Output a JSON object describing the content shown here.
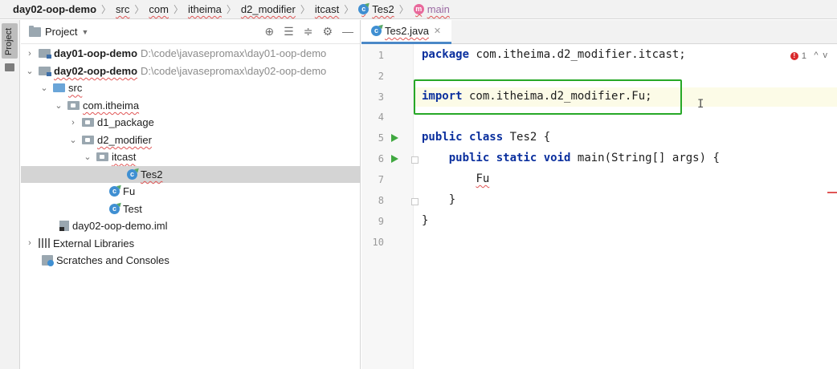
{
  "breadcrumb": {
    "items": [
      "day02-oop-demo",
      "src",
      "com",
      "itheima",
      "d2_modifier",
      "itcast",
      "Tes2",
      "main"
    ],
    "separator": "〉"
  },
  "toolstrip": {
    "project_tab": "Project"
  },
  "project_panel": {
    "title": "Project",
    "tree": [
      {
        "label": "day01-oop-demo",
        "path": "D:\\code\\javasepromax\\day01-oop-demo"
      },
      {
        "label": "day02-oop-demo",
        "path": "D:\\code\\javasepromax\\day02-oop-demo"
      },
      {
        "label": "src"
      },
      {
        "label": "com.itheima"
      },
      {
        "label": "d1_package"
      },
      {
        "label": "d2_modifier"
      },
      {
        "label": "itcast"
      },
      {
        "label": "Tes2"
      },
      {
        "label": "Fu"
      },
      {
        "label": "Test"
      },
      {
        "label": "day02-oop-demo.iml"
      },
      {
        "label": "External Libraries"
      },
      {
        "label": "Scratches and Consoles"
      }
    ]
  },
  "editor": {
    "tab_label": "Tes2.java",
    "error_count": "1",
    "line_numbers": [
      "1",
      "2",
      "3",
      "4",
      "5",
      "6",
      "7",
      "8",
      "9",
      "10"
    ],
    "code": {
      "l1_kw": "package",
      "l1_rest": " com.itheima.d2_modifier.itcast;",
      "l3_kw": "import",
      "l3_rest": " com.itheima.d2_modifier.Fu;",
      "l5_kw1": "public",
      "l5_kw2": "class",
      "l5_rest": " Tes2 {",
      "l6_kw1": "public",
      "l6_kw2": "static",
      "l6_kw3": "void",
      "l6_rest": " main(String[] args) {",
      "l7": "Fu",
      "l8": "}",
      "l9": "}"
    }
  },
  "colors": {
    "highlight_box": "#27a827",
    "keyword": "#0a2f9e",
    "run_icon": "#40a840",
    "error": "#d9292b"
  }
}
